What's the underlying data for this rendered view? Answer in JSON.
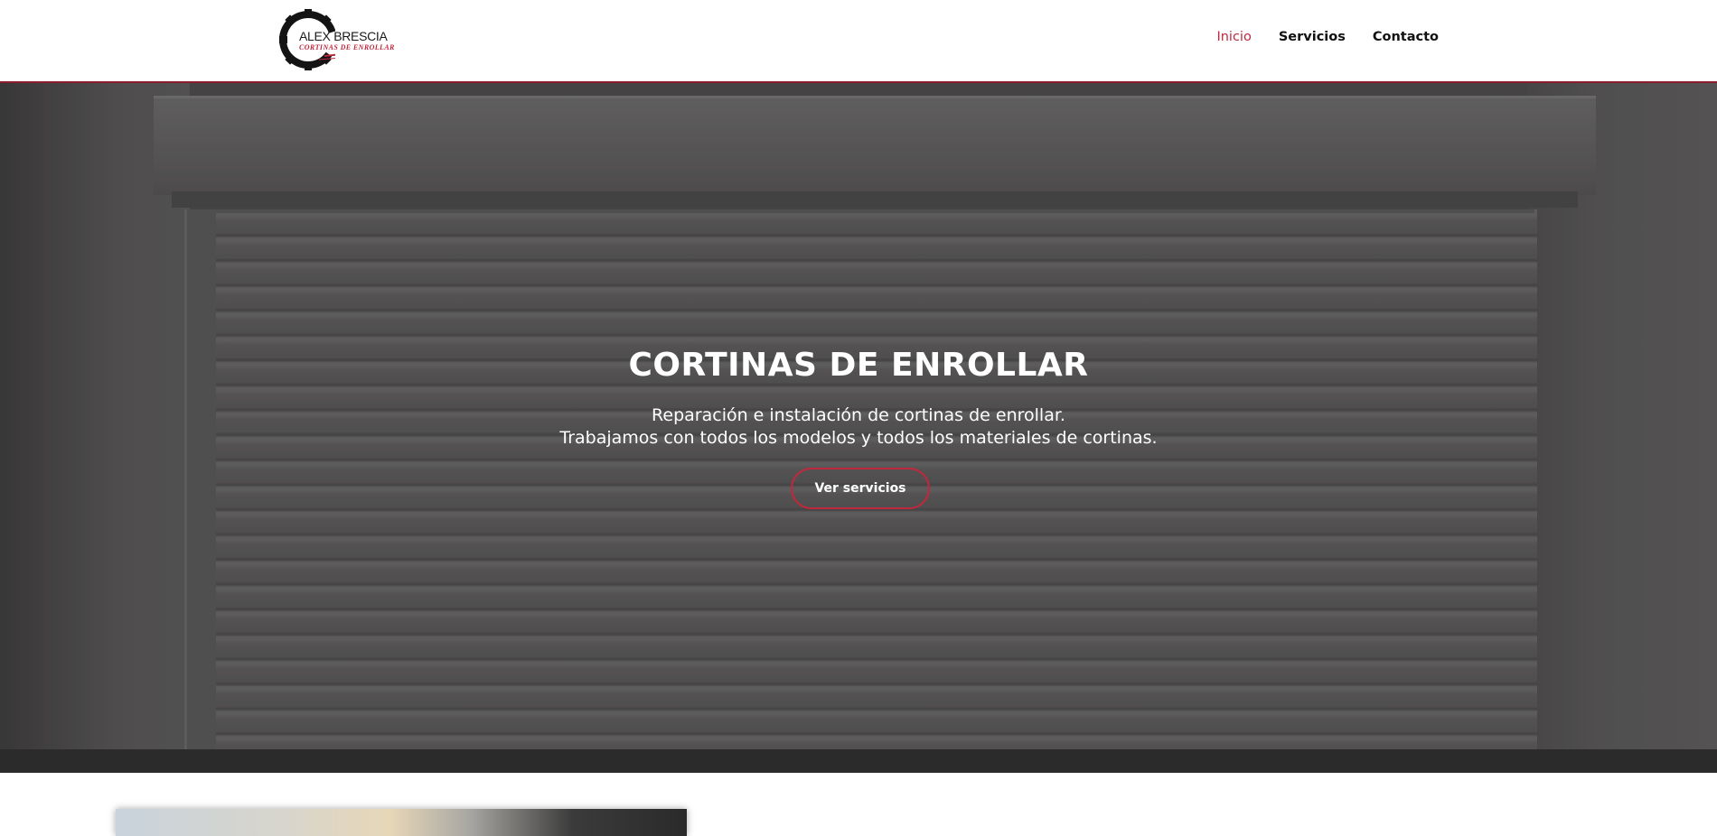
{
  "header": {
    "logo": {
      "brand_name": "ALEX BRESCIA",
      "tagline": "CORTINAS DE ENROLLAR"
    },
    "nav": [
      {
        "label": "Inicio",
        "active": true
      },
      {
        "label": "Servicios",
        "active": false
      },
      {
        "label": "Contacto",
        "active": false
      }
    ]
  },
  "hero": {
    "title": "CORTINAS DE ENROLLAR",
    "subtitle_line1": "Reparación e instalación de cortinas de enrollar.",
    "subtitle_line2": "Trabajamos con todos los modelos y todos los materiales de cortinas.",
    "cta_label": "Ver servicios"
  },
  "colors": {
    "accent": "#c0283e",
    "text_dark": "#111111",
    "hero_text": "#ffffff"
  },
  "icons": {
    "logo_icon": "gear-icon"
  }
}
